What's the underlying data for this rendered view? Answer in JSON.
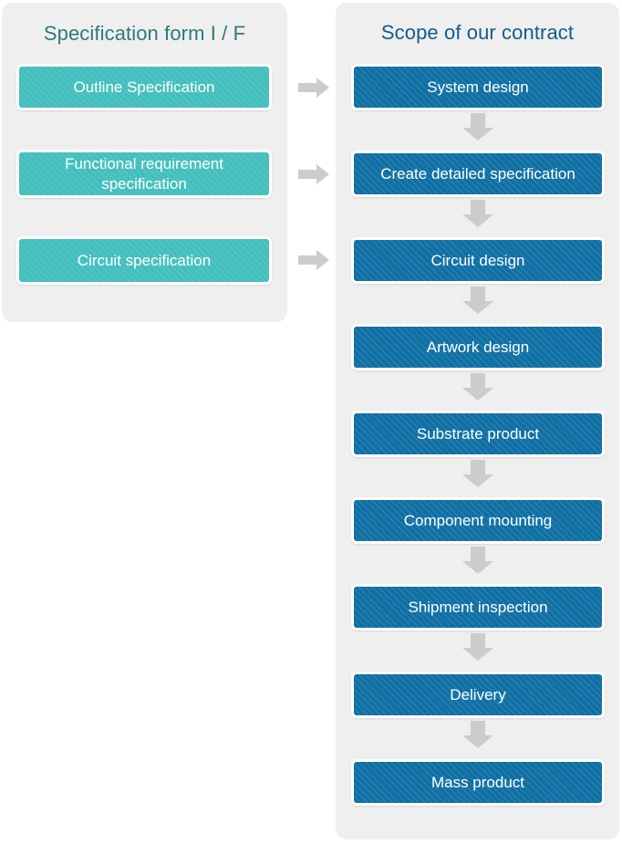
{
  "colors": {
    "panel_background": "#efefef",
    "teal_box": "#43bfbd",
    "blue_box": "#1070a4",
    "teal_title_text": "#2d7b78",
    "blue_title_text": "#135c8d",
    "arrow_gray": "#cccccc",
    "box_border": "#ffffff",
    "box_text": "#ffffff"
  },
  "left_panel": {
    "title": "Specification form I / F",
    "items": [
      {
        "label": "Outline Specification"
      },
      {
        "label": "Functional requirement specification"
      },
      {
        "label": "Circuit specification"
      }
    ]
  },
  "connectors": {
    "horizontal": [
      {
        "icon": "arrow-right-icon"
      },
      {
        "icon": "arrow-right-icon"
      },
      {
        "icon": "arrow-right-icon"
      }
    ],
    "vertical_icon": "arrow-down-icon"
  },
  "right_panel": {
    "title": "Scope of our contract",
    "steps": [
      {
        "label": "System design"
      },
      {
        "label": "Create detailed specification"
      },
      {
        "label": "Circuit design"
      },
      {
        "label": "Artwork design"
      },
      {
        "label": "Substrate product"
      },
      {
        "label": "Component mounting"
      },
      {
        "label": "Shipment inspection"
      },
      {
        "label": "Delivery"
      },
      {
        "label": "Mass product"
      }
    ]
  }
}
